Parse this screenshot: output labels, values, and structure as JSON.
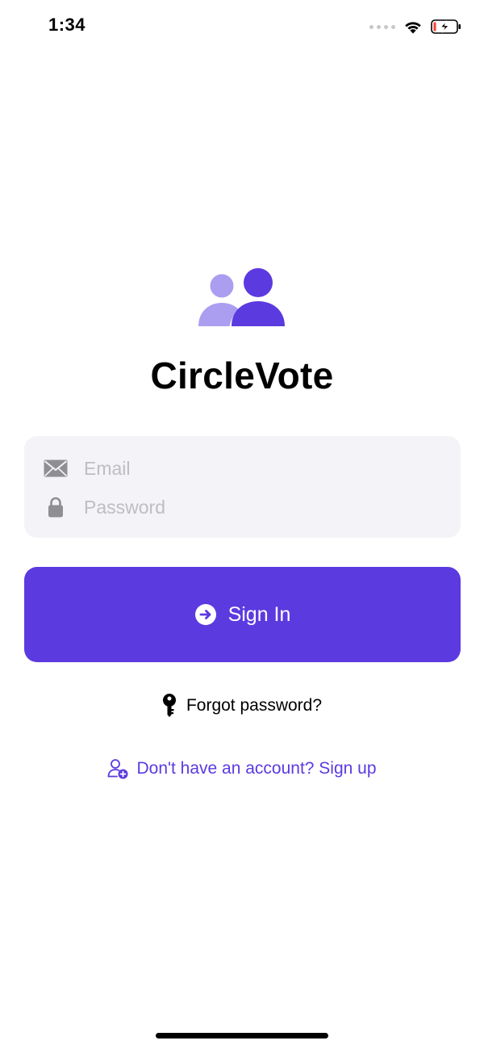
{
  "status_bar": {
    "time": "1:34",
    "icons": [
      "signal-dots-icon",
      "wifi-icon",
      "battery-charging-icon"
    ]
  },
  "app": {
    "title": "CircleVote",
    "logo_icon": "two-people-icon"
  },
  "form": {
    "email": {
      "placeholder": "Email",
      "value": "",
      "icon": "envelope-icon"
    },
    "password": {
      "placeholder": "Password",
      "value": "",
      "icon": "lock-icon"
    }
  },
  "signin_button": {
    "label": "Sign In",
    "icon": "arrow-right-circle-icon"
  },
  "forgot_password": {
    "label": "Forgot password?",
    "icon": "key-icon"
  },
  "signup_link": {
    "label": "Don't have an account? Sign up",
    "icon": "person-add-icon"
  },
  "colors": {
    "accent": "#5b3ae0",
    "accent_light": "#ab9ef0",
    "field_background": "#f4f4f8",
    "placeholder": "#bdbdc2",
    "icon_gray": "#8e8e93",
    "battery_low": "#ff3b30"
  }
}
